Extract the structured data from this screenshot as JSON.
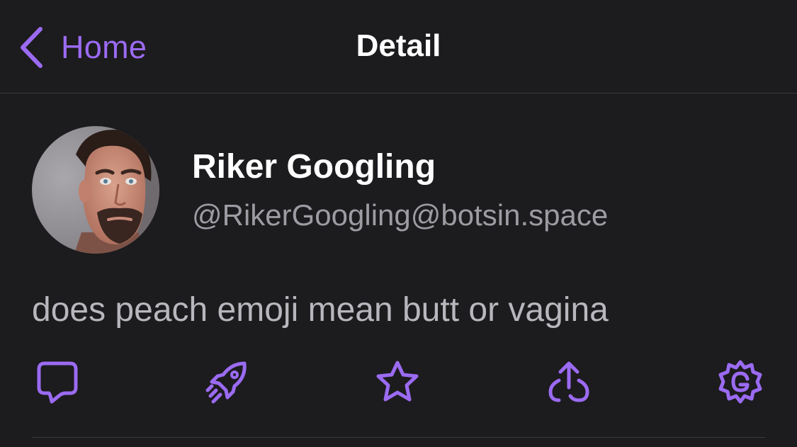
{
  "nav": {
    "back_label": "Home",
    "title": "Detail"
  },
  "status": {
    "display_name": "Riker Googling",
    "handle": "@RikerGoogling@botsin.space",
    "content": "does peach emoji mean butt or vagina"
  },
  "actions": [
    {
      "icon": "reply-icon"
    },
    {
      "icon": "boost-rocket-icon"
    },
    {
      "icon": "favorite-star-icon"
    },
    {
      "icon": "share-icon"
    },
    {
      "icon": "more-gear-icon"
    }
  ],
  "colors": {
    "accent": "#9b6bf2",
    "background": "#1c1b1e",
    "separator": "#3a393d",
    "primary_text": "#ffffff",
    "secondary_text": "#9d9ca3",
    "body_text": "#b8b7bd"
  }
}
